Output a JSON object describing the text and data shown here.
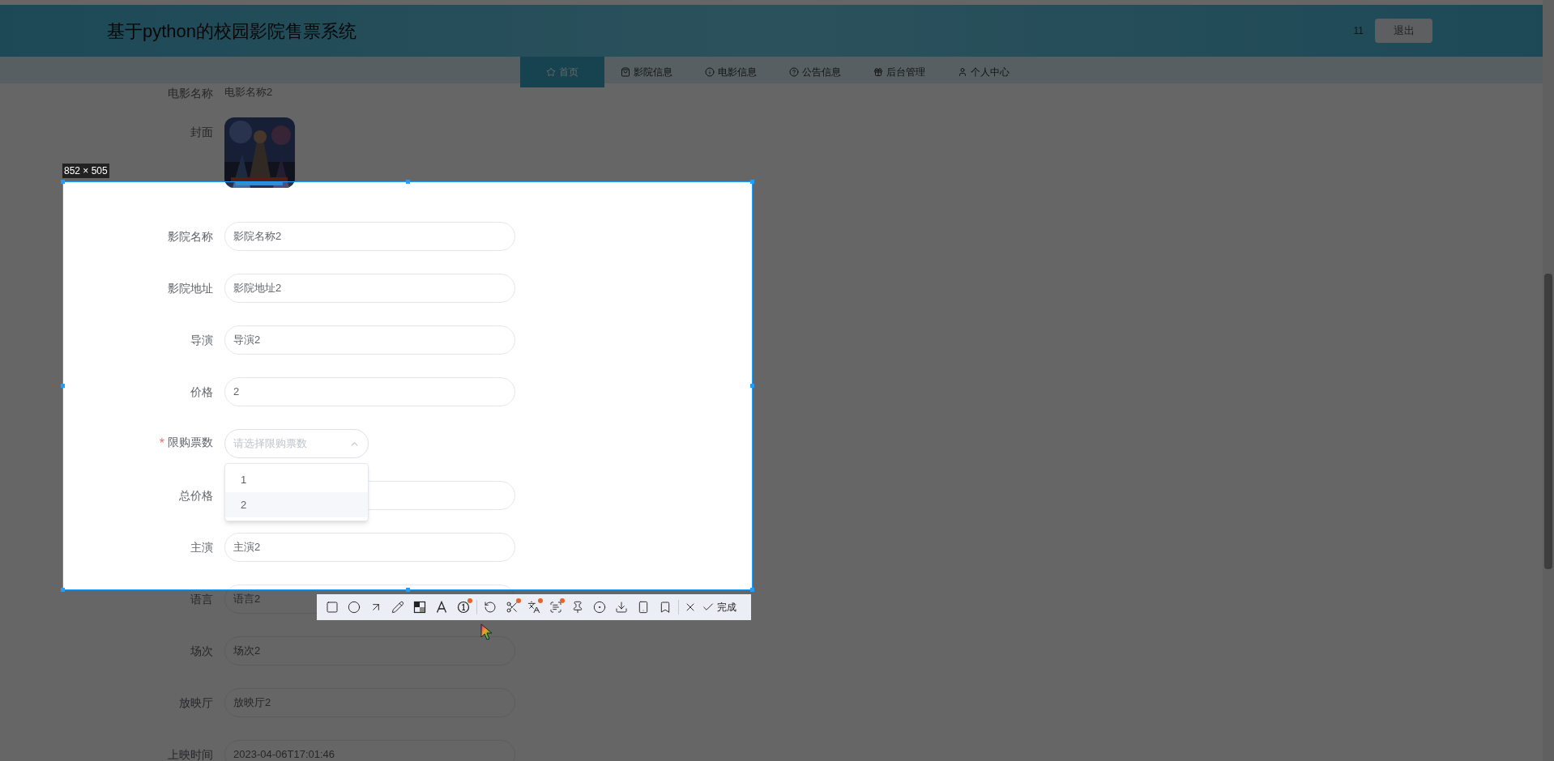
{
  "header": {
    "title": "基于python的校园影院售票系统",
    "user": "11",
    "logout": "退出"
  },
  "nav": [
    {
      "label": "首页",
      "selected": true
    },
    {
      "label": "影院信息",
      "selected": false
    },
    {
      "label": "电影信息",
      "selected": false
    },
    {
      "label": "公告信息",
      "selected": false
    },
    {
      "label": "后台管理",
      "selected": false
    },
    {
      "label": "个人中心",
      "selected": false
    }
  ],
  "form": {
    "fields": [
      {
        "kind": "partial",
        "label": "电影名称",
        "value": "电影名称2"
      },
      {
        "label": "封面"
      },
      {
        "kind": "text",
        "label": "影院名称",
        "value": "影院名称2"
      },
      {
        "kind": "text",
        "label": "影院地址",
        "value": "影院地址2"
      },
      {
        "kind": "text",
        "label": "导演",
        "value": "导演2"
      },
      {
        "kind": "text",
        "label": "价格",
        "value": "2"
      },
      {
        "kind": "select",
        "label": "限购票数",
        "placeholder": "请选择限购票数",
        "required_mark": "*",
        "expanded": true,
        "options": [
          {
            "label": "1",
            "selected": false
          },
          {
            "label": "2",
            "selected": true
          }
        ]
      },
      {
        "kind": "text",
        "label": "总价格"
      },
      {
        "kind": "text",
        "label": "主演",
        "value": "主演2"
      },
      {
        "kind": "text",
        "label": "语言",
        "value": "语言2"
      },
      {
        "kind": "text",
        "label": "场次",
        "value": "场次2"
      },
      {
        "kind": "text",
        "label": "放映厅",
        "value": "放映厅2"
      },
      {
        "kind": "text",
        "label": "上映时间",
        "value": "2023-04-06T17:01:46"
      }
    ]
  },
  "capture": {
    "size_label": "852 × 505",
    "done_label": "完成",
    "tools": [
      {
        "dot": false
      },
      {
        "dot": false
      },
      {
        "dot": false
      },
      {
        "dot": false
      },
      {
        "dot": false
      },
      {
        "dot": false
      },
      {
        "dot": true
      },
      {
        "dot": false
      },
      {
        "dot": true
      },
      {
        "dot": true
      },
      {
        "dot": true
      },
      {
        "dot": false
      },
      {
        "dot": false
      },
      {
        "dot": false
      },
      {
        "dot": false
      },
      {
        "dot": false
      }
    ]
  }
}
